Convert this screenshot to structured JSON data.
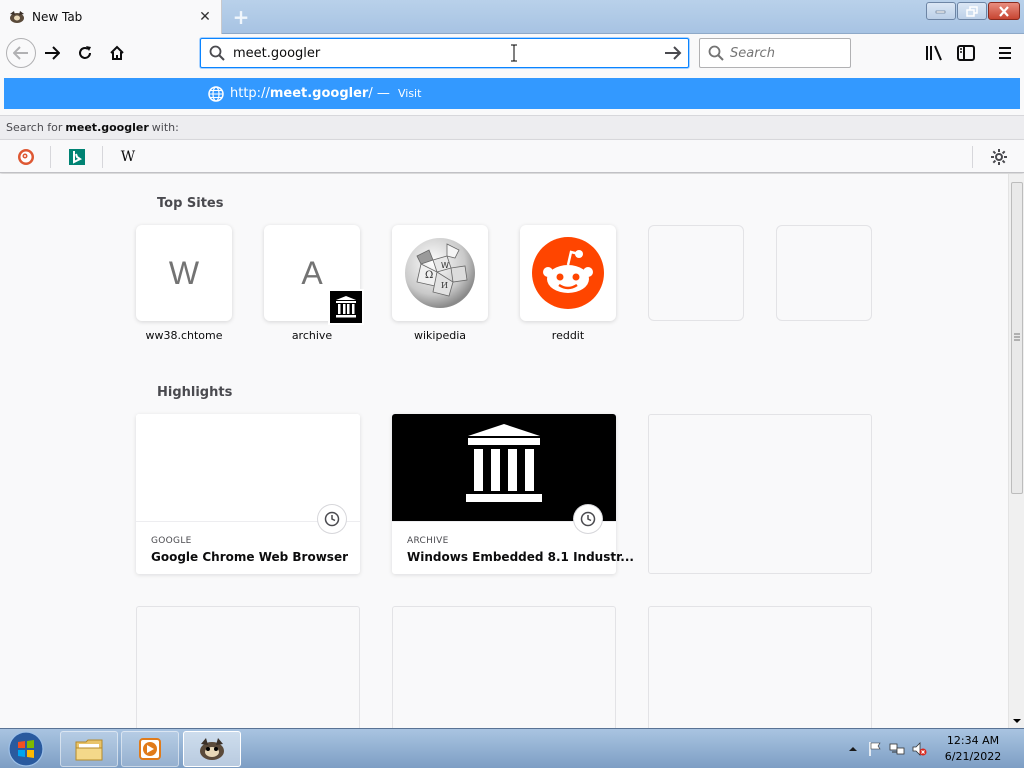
{
  "tab": {
    "title": "New Tab",
    "close": "✕",
    "new_tab": "+"
  },
  "urlbar": {
    "value": "meet.googler"
  },
  "searchbox": {
    "placeholder": "Search"
  },
  "popup": {
    "url_prefix": "http://",
    "url_domain": "meet.googler",
    "url_suffix": "/",
    "separator": " — ",
    "action": "Visit"
  },
  "search_with": {
    "prefix": "Search for",
    "term": "meet.googler",
    "suffix": "with:"
  },
  "engines": [
    {
      "name": "DuckDuckGo",
      "icon": "duckduckgo-icon"
    },
    {
      "name": "Bing",
      "icon": "bing-icon"
    },
    {
      "name": "Wikipedia",
      "icon": "wikipedia-icon",
      "glyph": "W"
    }
  ],
  "top_sites": {
    "title": "Top Sites",
    "items": [
      {
        "label": "ww38.chtome",
        "letter": "W"
      },
      {
        "label": "archive",
        "letter": "A"
      },
      {
        "label": "wikipedia"
      },
      {
        "label": "reddit"
      }
    ]
  },
  "highlights": {
    "title": "Highlights",
    "cards": [
      {
        "source": "GOOGLE",
        "title": "Google Chrome Web Browser"
      },
      {
        "source": "ARCHIVE",
        "title": "Windows Embedded 8.1 Industr..."
      }
    ]
  },
  "taskbar": {
    "time": "12:34 AM",
    "date": "6/21/2022"
  },
  "colors": {
    "accent": "#0a84ff",
    "popup_highlight": "#3399ff",
    "reddit": "#ff4500"
  }
}
